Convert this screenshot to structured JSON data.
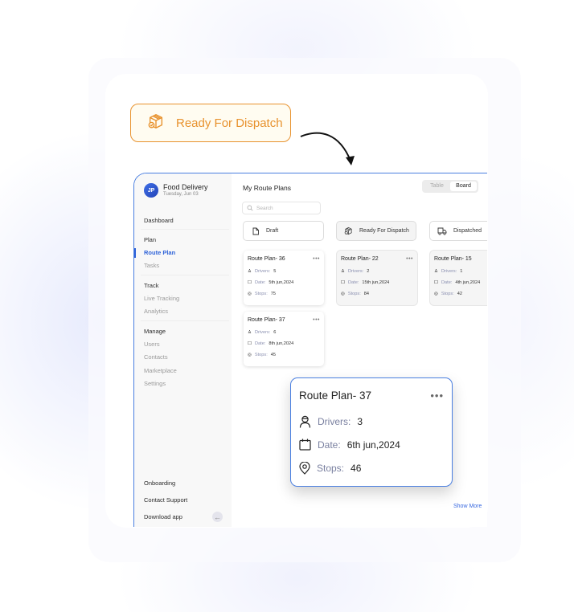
{
  "status_badge": {
    "label": "Ready For Dispatch",
    "icon": "package-check-icon",
    "color": "#e8922e"
  },
  "app": {
    "brand": {
      "avatar_initials": "JP",
      "name": "Food Delivery",
      "date": "Tuesday, Jun 03"
    },
    "sidebar": {
      "dashboard": "Dashboard",
      "sections": [
        {
          "heading": "Plan",
          "items": [
            "Route Plan",
            "Tasks"
          ]
        },
        {
          "heading": "Track",
          "items": [
            "Live Tracking",
            "Analytics"
          ]
        },
        {
          "heading": "Manage",
          "items": [
            "Users",
            "Contacts",
            "Marketplace",
            "Settings"
          ]
        }
      ],
      "active_item": "Route Plan",
      "footer": [
        "Onboarding",
        "Contact Support",
        "Download app"
      ],
      "collapse_icon": "arrow-left-icon"
    },
    "main": {
      "title": "My Route Plans",
      "view_toggle": {
        "options": [
          "Table",
          "Board"
        ],
        "selected": "Board"
      },
      "search_placeholder": "Search",
      "columns": [
        {
          "label": "Draft",
          "icon": "document-icon",
          "cards": [
            {
              "title": "Route Plan- 36",
              "drivers": "5",
              "date": "5th jun,2024",
              "stops": "75"
            },
            {
              "title": "Route Plan- 37",
              "drivers": "6",
              "date": "8th jun,2024",
              "stops": "45"
            }
          ]
        },
        {
          "label": "Ready For Dispatch",
          "icon": "package-check-icon",
          "cards": [
            {
              "title": "Route Plan- 22",
              "drivers": "2",
              "date": "15th jun,2024",
              "stops": "84"
            }
          ]
        },
        {
          "label": "Dispatched",
          "icon": "truck-icon",
          "cards": [
            {
              "title": "Route Plan- 15",
              "drivers": "1",
              "date": "4th jun,2024",
              "stops": "42"
            }
          ]
        }
      ],
      "labels": {
        "drivers": "Drivers:",
        "date": "Date:",
        "stops": "Stops:"
      },
      "show_more": "Show More"
    },
    "dragged_card": {
      "title": "Route Plan- 37",
      "drivers": "3",
      "date": "6th jun,2024",
      "stops": "46"
    }
  },
  "colors": {
    "accent": "#2f63d8",
    "frame": "#4a7fe0",
    "status": "#e8922e"
  }
}
